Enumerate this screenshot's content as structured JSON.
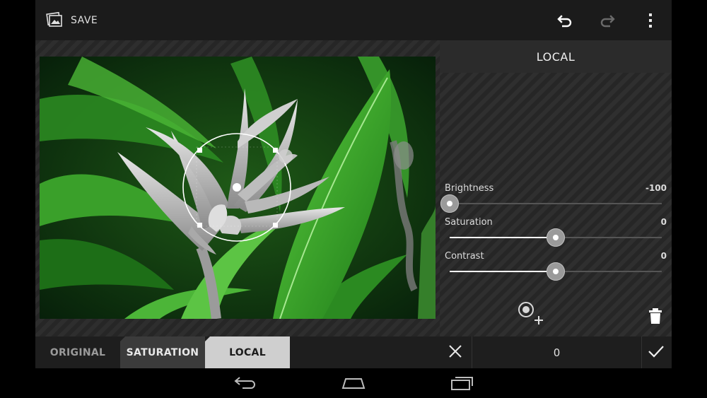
{
  "topbar": {
    "save_label": "SAVE",
    "icons": [
      "gallery-icon",
      "undo-icon",
      "redo-icon",
      "overflow-menu-icon"
    ]
  },
  "panel": {
    "title": "LOCAL",
    "sliders": [
      {
        "label": "Brightness",
        "value": "-100",
        "fraction": 0.0
      },
      {
        "label": "Saturation",
        "value": "0",
        "fraction": 0.5
      },
      {
        "label": "Contrast",
        "value": "0",
        "fraction": 0.5
      }
    ],
    "icons": [
      "add-control-point-icon",
      "trash-icon"
    ]
  },
  "bottombar": {
    "tabs": [
      {
        "label": "ORIGINAL",
        "state": "inactive"
      },
      {
        "label": "SATURATION",
        "state": "previous"
      },
      {
        "label": "LOCAL",
        "state": "active"
      }
    ],
    "value": "0",
    "icons": [
      "cancel-icon",
      "apply-check-icon"
    ]
  },
  "navbar": {
    "icons": [
      "back-icon",
      "home-icon",
      "recent-apps-icon"
    ]
  },
  "colors": {
    "app_bg": "#2a2a2a",
    "topbar_bg": "#1b1b1b",
    "active_tab_bg": "#cfcfcf",
    "leaf_green": "#3fae2a"
  }
}
